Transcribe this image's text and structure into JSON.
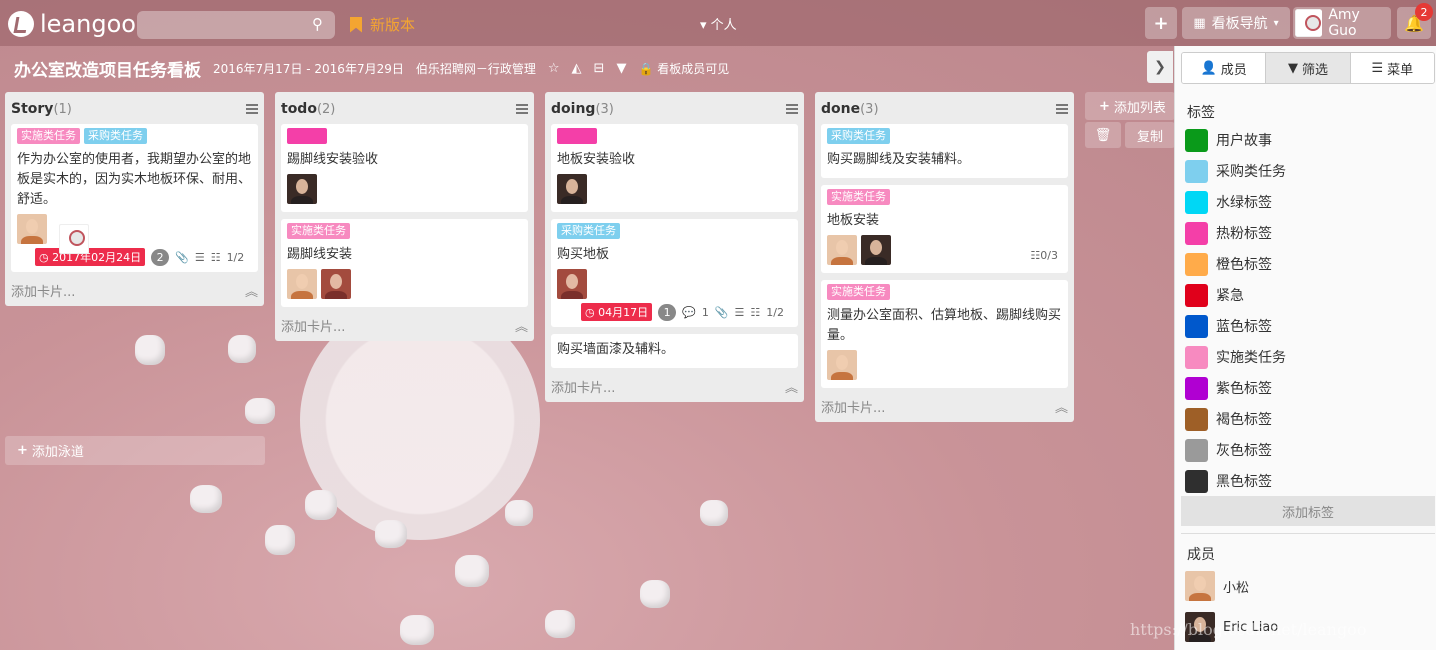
{
  "app": {
    "logo_text": "leangoo",
    "new_version": "新版本",
    "personal": "个人",
    "board_nav": "看板导航",
    "user": "Amy Guo",
    "notifications": "2",
    "search_placeholder": ""
  },
  "board": {
    "title": "办公室改造项目任务看板",
    "dates": "2016年7月17日 - 2016年7月29日",
    "org": "伯乐招聘网－行政管理",
    "visibility": "看板成员可见"
  },
  "lists": [
    {
      "name": "Story",
      "count": "(1)",
      "add": "添加卡片...",
      "cards": [
        {
          "tags": [
            "实施类任务",
            "采购类任务"
          ],
          "text": "作为办公室的使用者，我期望办公室的地板是实木的，因为实木地板环保、耐用、舒适。",
          "due": "2017年02月24日",
          "comments": "2",
          "checklist": "1/2"
        }
      ]
    },
    {
      "name": "todo",
      "count": "(2)",
      "add": "添加卡片...",
      "cards": [
        {
          "text": "踢脚线安装验收"
        },
        {
          "tags": [
            "实施类任务"
          ],
          "text": "踢脚线安装"
        }
      ]
    },
    {
      "name": "doing",
      "count": "(3)",
      "add": "添加卡片...",
      "cards": [
        {
          "text": "地板安装验收"
        },
        {
          "tags": [
            "采购类任务"
          ],
          "text": "购买地板",
          "due": "04月17日",
          "comments": "1",
          "replies": "1",
          "checklist": "1/2"
        },
        {
          "text": "购买墙面漆及辅料。"
        }
      ]
    },
    {
      "name": "done",
      "count": "(3)",
      "add": "添加卡片...",
      "cards": [
        {
          "tags": [
            "采购类任务"
          ],
          "text": "购买踢脚线及安装辅料。"
        },
        {
          "tags": [
            "实施类任务"
          ],
          "text": "地板安装",
          "checklist": "0/3"
        },
        {
          "tags": [
            "实施类任务"
          ],
          "text": "测量办公室面积、估算地板、踢脚线购买量。"
        }
      ]
    }
  ],
  "add_list": "添加列表",
  "delete": "",
  "copy": "复制",
  "add_lane": "添加泳道",
  "panel": {
    "tabs": [
      "成员",
      "筛选",
      "菜单"
    ],
    "labels_title": "标签",
    "labels": [
      {
        "name": "用户故事",
        "color": "#0a9a1a"
      },
      {
        "name": "采购类任务",
        "color": "#7ecfee"
      },
      {
        "name": "水绿标签",
        "color": "#00d7f5"
      },
      {
        "name": "热粉标签",
        "color": "#f43fa8"
      },
      {
        "name": "橙色标签",
        "color": "#ffab4a"
      },
      {
        "name": "紧急",
        "color": "#e0001b"
      },
      {
        "name": "蓝色标签",
        "color": "#0058cc"
      },
      {
        "name": "实施类任务",
        "color": "#f78ac0"
      },
      {
        "name": "紫色标签",
        "color": "#b000d2"
      },
      {
        "name": "褐色标签",
        "color": "#9e5f27"
      },
      {
        "name": "灰色标签",
        "color": "#9a9a9a"
      },
      {
        "name": "黑色标签",
        "color": "#2f2f2f"
      }
    ],
    "add_label": "添加标签",
    "members_title": "成员",
    "members": [
      "小松",
      "Eric Liao"
    ]
  },
  "watermark": "https://blog.csdn.net/leangoo"
}
